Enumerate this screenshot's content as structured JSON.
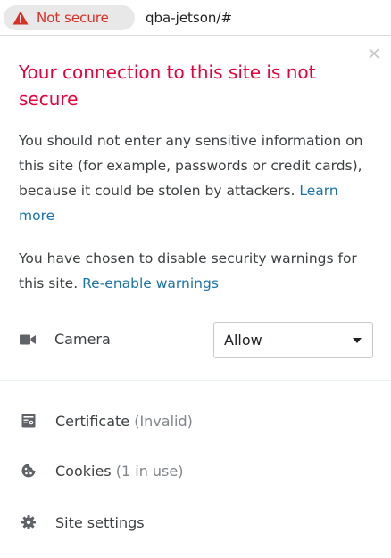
{
  "urlbar": {
    "security_label": "Not secure",
    "url": "qba-jetson/#"
  },
  "panel": {
    "title": "Your connection to this site is not secure",
    "warning_text": "You should not enter any sensitive information on this site (for example, passwords or credit cards), because it could be stolen by attackers.",
    "learn_more": "Learn more",
    "disabled_text": "You have chosen to disable security warnings for this site.",
    "reenable": "Re-enable warnings"
  },
  "permissions": {
    "camera_label": "Camera",
    "camera_value": "Allow"
  },
  "menu": {
    "certificate": "Certificate",
    "certificate_status": "(Invalid)",
    "cookies": "Cookies",
    "cookies_status": "(1 in use)",
    "site_settings": "Site settings"
  },
  "colors": {
    "danger": "#d93025",
    "title": "#e8003a",
    "link": "#1a73a8",
    "text": "#3c4043"
  }
}
